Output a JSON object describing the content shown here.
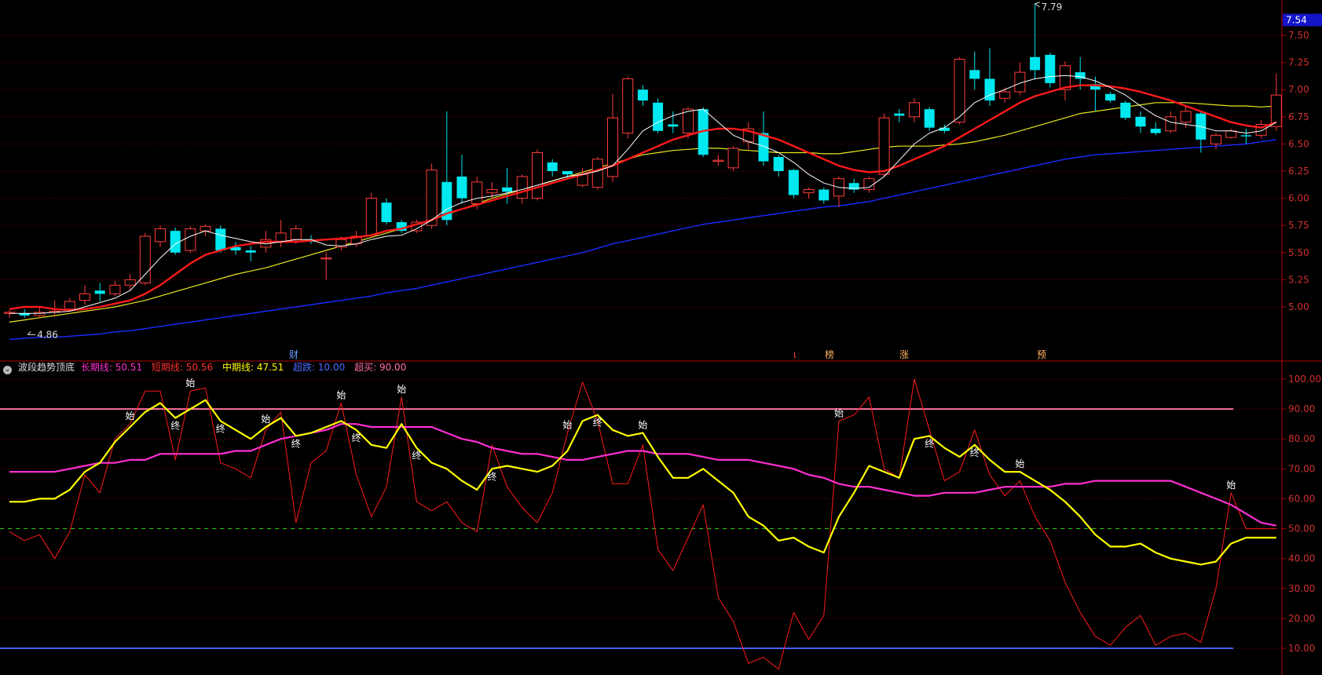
{
  "indicator": {
    "name": "波段趋势顶底",
    "long_label": "长期线:",
    "long_value": "50.51",
    "long_color": "#ff2fd0",
    "short_label": "短期线:",
    "short_value": "50.56",
    "short_color": "#ff3030",
    "mid_label": "中期线:",
    "mid_value": "47.51",
    "mid_color": "#ffff00",
    "oversold_label": "超跌:",
    "oversold_value": "10.00",
    "oversold_color": "#4a5cff",
    "overbought_label": "超买:",
    "overbought_value": "90.00",
    "overbought_color": "#ff6fa0"
  },
  "chart_data": [
    {
      "type": "candlestick",
      "price_axis": {
        "ticks": [
          "7.50",
          "7.25",
          "7.00",
          "6.75",
          "6.50",
          "6.25",
          "6.00",
          "5.75",
          "5.50",
          "5.25",
          "5.00"
        ],
        "range": [
          4.5,
          7.75
        ]
      },
      "current_price": "7.54",
      "high_label": "7.79",
      "low_label": "4.86",
      "event_markers": [
        "财",
        "ι",
        "榜",
        "涨",
        "预"
      ],
      "candles": [
        [
          4.94,
          4.95,
          4.9,
          4.97
        ],
        [
          4.94,
          4.92,
          4.9,
          4.98
        ],
        [
          4.92,
          4.95,
          4.9,
          4.99
        ],
        [
          4.95,
          4.96,
          4.91,
          5.06
        ],
        [
          4.98,
          5.05,
          4.96,
          5.08
        ],
        [
          5.06,
          5.12,
          5.02,
          5.2
        ],
        [
          5.15,
          5.12,
          5.05,
          5.22
        ],
        [
          5.12,
          5.2,
          5.1,
          5.24
        ],
        [
          5.2,
          5.25,
          5.15,
          5.3
        ],
        [
          5.22,
          5.65,
          5.2,
          5.68
        ],
        [
          5.6,
          5.72,
          5.55,
          5.75
        ],
        [
          5.7,
          5.5,
          5.48,
          5.73
        ],
        [
          5.52,
          5.72,
          5.5,
          5.74
        ],
        [
          5.7,
          5.74,
          5.65,
          5.76
        ],
        [
          5.72,
          5.52,
          5.5,
          5.75
        ],
        [
          5.55,
          5.52,
          5.48,
          5.6
        ],
        [
          5.52,
          5.5,
          5.42,
          5.56
        ],
        [
          5.55,
          5.62,
          5.5,
          5.7
        ],
        [
          5.6,
          5.68,
          5.55,
          5.8
        ],
        [
          5.62,
          5.72,
          5.58,
          5.75
        ],
        [
          5.62,
          5.6,
          5.58,
          5.66
        ],
        [
          5.45,
          5.45,
          5.25,
          5.5
        ],
        [
          5.55,
          5.62,
          5.52,
          5.65
        ],
        [
          5.58,
          5.65,
          5.55,
          5.7
        ],
        [
          5.66,
          6.0,
          5.64,
          6.05
        ],
        [
          5.96,
          5.78,
          5.76,
          6.0
        ],
        [
          5.78,
          5.7,
          5.68,
          5.8
        ],
        [
          5.7,
          5.78,
          5.68,
          5.8
        ],
        [
          5.75,
          6.26,
          5.72,
          6.32
        ],
        [
          6.15,
          5.8,
          5.75,
          6.8
        ],
        [
          6.2,
          6.0,
          5.95,
          6.4
        ],
        [
          5.95,
          6.15,
          5.9,
          6.2
        ],
        [
          6.05,
          6.08,
          6.0,
          6.15
        ],
        [
          6.1,
          6.06,
          5.95,
          6.28
        ],
        [
          6.0,
          6.2,
          5.95,
          6.22
        ],
        [
          6.0,
          6.42,
          5.98,
          6.45
        ],
        [
          6.33,
          6.25,
          6.2,
          6.36
        ],
        [
          6.25,
          6.22,
          6.18,
          6.25
        ],
        [
          6.12,
          6.22,
          6.1,
          6.28
        ],
        [
          6.1,
          6.36,
          6.08,
          6.38
        ],
        [
          6.2,
          6.74,
          6.15,
          6.96
        ],
        [
          6.6,
          7.1,
          6.55,
          7.12
        ],
        [
          7.0,
          6.9,
          6.85,
          7.04
        ],
        [
          6.88,
          6.62,
          6.6,
          6.92
        ],
        [
          6.68,
          6.66,
          6.6,
          6.8
        ],
        [
          6.6,
          6.82,
          6.55,
          6.84
        ],
        [
          6.82,
          6.4,
          6.38,
          6.84
        ],
        [
          6.34,
          6.35,
          6.3,
          6.4
        ],
        [
          6.28,
          6.46,
          6.25,
          6.48
        ],
        [
          6.52,
          6.64,
          6.45,
          6.7
        ],
        [
          6.6,
          6.34,
          6.3,
          6.8
        ],
        [
          6.38,
          6.25,
          6.2,
          6.4
        ],
        [
          6.26,
          6.03,
          6.0,
          6.27
        ],
        [
          6.05,
          6.08,
          6.0,
          6.1
        ],
        [
          6.08,
          5.98,
          5.95,
          6.1
        ],
        [
          6.02,
          6.18,
          5.92,
          6.2
        ],
        [
          6.14,
          6.08,
          6.05,
          6.18
        ],
        [
          6.08,
          6.18,
          6.05,
          6.2
        ],
        [
          6.22,
          6.74,
          6.2,
          6.78
        ],
        [
          6.78,
          6.76,
          6.7,
          6.82
        ],
        [
          6.75,
          6.88,
          6.7,
          6.92
        ],
        [
          6.82,
          6.65,
          6.62,
          6.84
        ],
        [
          6.65,
          6.62,
          6.6,
          6.68
        ],
        [
          6.7,
          7.28,
          6.68,
          7.3
        ],
        [
          7.18,
          7.1,
          7.0,
          7.35
        ],
        [
          7.1,
          6.9,
          6.85,
          7.38
        ],
        [
          6.92,
          6.98,
          6.88,
          7.02
        ],
        [
          6.98,
          7.16,
          6.95,
          7.25
        ],
        [
          7.3,
          7.18,
          7.1,
          7.79
        ],
        [
          7.32,
          7.06,
          7.02,
          7.34
        ],
        [
          7.0,
          7.22,
          6.9,
          7.26
        ],
        [
          7.16,
          7.1,
          7.0,
          7.3
        ],
        [
          7.05,
          7.0,
          6.8,
          7.12
        ],
        [
          6.96,
          6.9,
          6.88,
          6.98
        ],
        [
          6.88,
          6.74,
          6.72,
          6.9
        ],
        [
          6.75,
          6.66,
          6.6,
          6.8
        ],
        [
          6.64,
          6.6,
          6.58,
          6.7
        ],
        [
          6.62,
          6.75,
          6.6,
          6.8
        ],
        [
          6.7,
          6.8,
          6.65,
          6.85
        ],
        [
          6.78,
          6.54,
          6.42,
          6.8
        ],
        [
          6.5,
          6.58,
          6.45,
          6.6
        ],
        [
          6.56,
          6.62,
          6.55,
          6.64
        ],
        [
          6.58,
          6.57,
          6.5,
          6.64
        ],
        [
          6.58,
          6.68,
          6.55,
          6.72
        ],
        [
          6.66,
          6.95,
          6.62,
          7.15
        ]
      ],
      "ma_fast_color": "#ffffff",
      "ma_red_color": "#ff1a1a",
      "ma_yellow_color": "#e8e820",
      "ma_blue_color": "#1a2cff",
      "ma_fast": [
        4.94,
        4.94,
        4.94,
        4.95,
        4.96,
        5.0,
        5.04,
        5.08,
        5.15,
        5.3,
        5.45,
        5.58,
        5.65,
        5.7,
        5.66,
        5.63,
        5.6,
        5.58,
        5.6,
        5.62,
        5.62,
        5.57,
        5.56,
        5.58,
        5.62,
        5.65,
        5.66,
        5.72,
        5.8,
        5.9,
        5.96,
        6.0,
        6.02,
        6.05,
        6.08,
        6.12,
        6.16,
        6.2,
        6.22,
        6.25,
        6.3,
        6.45,
        6.62,
        6.7,
        6.76,
        6.8,
        6.82,
        6.7,
        6.58,
        6.52,
        6.48,
        6.42,
        6.33,
        6.22,
        6.14,
        6.1,
        6.09,
        6.1,
        6.2,
        6.35,
        6.5,
        6.6,
        6.65,
        6.75,
        6.88,
        6.95,
        7.0,
        7.06,
        7.1,
        7.12,
        7.13,
        7.12,
        7.08,
        7.02,
        6.95,
        6.85,
        6.76,
        6.7,
        6.68,
        6.66,
        6.62,
        6.62,
        6.6,
        6.62,
        6.7
      ],
      "ma_red": [
        4.98,
        5.0,
        5.0,
        4.98,
        4.97,
        4.98,
        5.0,
        5.03,
        5.06,
        5.12,
        5.2,
        5.3,
        5.4,
        5.48,
        5.52,
        5.56,
        5.58,
        5.6,
        5.6,
        5.6,
        5.61,
        5.62,
        5.63,
        5.64,
        5.66,
        5.7,
        5.72,
        5.76,
        5.8,
        5.86,
        5.9,
        5.94,
        5.98,
        6.02,
        6.06,
        6.1,
        6.14,
        6.18,
        6.22,
        6.26,
        6.3,
        6.36,
        6.42,
        6.48,
        6.54,
        6.58,
        6.62,
        6.64,
        6.64,
        6.62,
        6.58,
        6.54,
        6.48,
        6.42,
        6.36,
        6.3,
        6.26,
        6.24,
        6.25,
        6.3,
        6.36,
        6.42,
        6.48,
        6.56,
        6.64,
        6.72,
        6.8,
        6.88,
        6.94,
        6.98,
        7.02,
        7.04,
        7.04,
        7.03,
        7.01,
        6.98,
        6.94,
        6.9,
        6.85,
        6.8,
        6.75,
        6.7,
        6.67,
        6.65,
        6.7
      ],
      "ma_yellow": [
        4.86,
        4.88,
        4.9,
        4.92,
        4.94,
        4.96,
        4.98,
        5.0,
        5.03,
        5.06,
        5.1,
        5.14,
        5.18,
        5.22,
        5.26,
        5.3,
        5.33,
        5.36,
        5.4,
        5.44,
        5.48,
        5.52,
        5.56,
        5.6,
        5.64,
        5.68,
        5.72,
        5.76,
        5.8,
        5.85,
        5.9,
        5.95,
        6.0,
        6.04,
        6.08,
        6.12,
        6.16,
        6.2,
        6.24,
        6.28,
        6.32,
        6.36,
        6.4,
        6.42,
        6.44,
        6.45,
        6.46,
        6.46,
        6.45,
        6.44,
        6.43,
        6.42,
        6.42,
        6.42,
        6.41,
        6.41,
        6.43,
        6.45,
        6.47,
        6.48,
        6.48,
        6.48,
        6.49,
        6.5,
        6.52,
        6.55,
        6.58,
        6.62,
        6.66,
        6.7,
        6.74,
        6.78,
        6.8,
        6.82,
        6.84,
        6.86,
        6.88,
        6.88,
        6.88,
        6.87,
        6.86,
        6.85,
        6.85,
        6.84,
        6.85
      ],
      "ma_blue": [
        4.7,
        4.71,
        4.72,
        4.72,
        4.73,
        4.74,
        4.75,
        4.77,
        4.78,
        4.8,
        4.82,
        4.84,
        4.86,
        4.88,
        4.9,
        4.92,
        4.94,
        4.96,
        4.98,
        5.0,
        5.02,
        5.04,
        5.06,
        5.08,
        5.1,
        5.13,
        5.15,
        5.17,
        5.2,
        5.23,
        5.26,
        5.29,
        5.32,
        5.35,
        5.38,
        5.41,
        5.44,
        5.47,
        5.5,
        5.54,
        5.58,
        5.61,
        5.64,
        5.67,
        5.7,
        5.73,
        5.76,
        5.78,
        5.8,
        5.82,
        5.84,
        5.86,
        5.88,
        5.9,
        5.92,
        5.93,
        5.95,
        5.97,
        6.0,
        6.03,
        6.06,
        6.09,
        6.12,
        6.15,
        6.18,
        6.21,
        6.24,
        6.27,
        6.3,
        6.33,
        6.36,
        6.38,
        6.4,
        6.41,
        6.42,
        6.43,
        6.44,
        6.45,
        6.46,
        6.47,
        6.48,
        6.49,
        6.5,
        6.52,
        6.54
      ]
    },
    {
      "type": "line",
      "y_axis_ticks": [
        "100.00",
        "90.00",
        "80.00",
        "70.00",
        "60.00",
        "50.00",
        "40.00",
        "30.00",
        "20.00",
        "10.00"
      ],
      "ylim": [
        0,
        105
      ],
      "overbought": 90,
      "oversold": 10,
      "midline": 50,
      "series": [
        {
          "name": "长期线",
          "color": "#ff2fd0",
          "values": [
            69,
            69,
            69,
            69,
            70,
            71,
            72,
            72,
            73,
            73,
            75,
            75,
            75,
            75,
            75,
            76,
            76,
            78,
            80,
            81,
            82,
            83,
            85,
            85,
            84,
            84,
            84,
            84,
            84,
            82,
            80,
            79,
            77,
            76,
            75,
            75,
            74,
            73,
            73,
            74,
            75,
            76,
            76,
            75,
            75,
            75,
            74,
            73,
            73,
            73,
            72,
            71,
            70,
            68,
            67,
            65,
            64,
            64,
            63,
            62,
            61,
            61,
            62,
            62,
            62,
            63,
            64,
            64,
            64,
            64,
            65,
            65,
            66,
            66,
            66,
            66,
            66,
            66,
            64,
            62,
            60,
            58,
            55,
            52,
            51
          ]
        },
        {
          "name": "短期线",
          "color": "#ff1a1a",
          "values": [
            49,
            46,
            48,
            40,
            49,
            68,
            62,
            80,
            85,
            96,
            96,
            73,
            96,
            97,
            72,
            70,
            67,
            83,
            89,
            52,
            72,
            76,
            92,
            68,
            54,
            64,
            94,
            59,
            56,
            59,
            52,
            49,
            78,
            64,
            57,
            52,
            62,
            82,
            99,
            86,
            65,
            65,
            78,
            43,
            36,
            47,
            58,
            27,
            19,
            5,
            7,
            3,
            22,
            13,
            21,
            86,
            88,
            94,
            70,
            67,
            100,
            83,
            66,
            69,
            83,
            68,
            61,
            66,
            54,
            46,
            32,
            22,
            14,
            11,
            17,
            21,
            11,
            14,
            15,
            12,
            30,
            62,
            50,
            50,
            50
          ]
        },
        {
          "name": "中期线",
          "color": "#ffff00",
          "values": [
            59,
            59,
            60,
            60,
            63,
            69,
            72,
            79,
            84,
            89,
            92,
            87,
            90,
            93,
            86,
            83,
            80,
            84,
            87,
            81,
            82,
            84,
            86,
            83,
            78,
            77,
            85,
            77,
            72,
            70,
            66,
            63,
            70,
            71,
            70,
            69,
            71,
            76,
            86,
            88,
            83,
            81,
            82,
            74,
            67,
            67,
            70,
            66,
            62,
            54,
            51,
            46,
            47,
            44,
            42,
            54,
            62,
            71,
            69,
            67,
            80,
            81,
            77,
            74,
            78,
            73,
            69,
            69,
            66,
            63,
            59,
            54,
            48,
            44,
            44,
            45,
            42,
            40,
            39,
            38,
            39,
            45,
            47,
            47,
            47
          ]
        }
      ],
      "signals": [
        {
          "i": 8,
          "t": "始"
        },
        {
          "i": 12,
          "t": "始"
        },
        {
          "i": 11,
          "t": "终"
        },
        {
          "i": 14,
          "t": "终"
        },
        {
          "i": 17,
          "t": "始"
        },
        {
          "i": 19,
          "t": "终"
        },
        {
          "i": 22,
          "t": "始"
        },
        {
          "i": 23,
          "t": "终"
        },
        {
          "i": 26,
          "t": "始"
        },
        {
          "i": 27,
          "t": "终"
        },
        {
          "i": 32,
          "t": "终"
        },
        {
          "i": 37,
          "t": "始"
        },
        {
          "i": 39,
          "t": "终"
        },
        {
          "i": 42,
          "t": "始"
        },
        {
          "i": 55,
          "t": "始"
        },
        {
          "i": 61,
          "t": "终"
        },
        {
          "i": 64,
          "t": "终"
        },
        {
          "i": 67,
          "t": "始"
        },
        {
          "i": 81,
          "t": "始"
        }
      ]
    }
  ]
}
